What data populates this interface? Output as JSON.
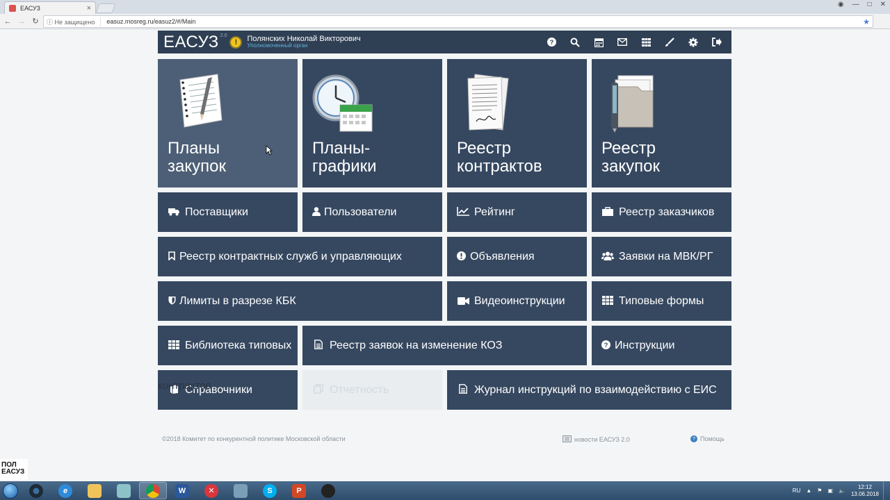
{
  "browser": {
    "tab_title": "ЕАСУЗ",
    "tab_close": "×",
    "security_label": "Не защищено",
    "url": "easuz.mosreg.ru/easuz2/#/Main"
  },
  "header": {
    "logo": "ЕАСУЗ",
    "logo_version": "2.0",
    "warning_mark": "!",
    "user_name": "Полянских Николай Викторович",
    "user_role": "Уполномоченный орган",
    "icons": [
      "question-circle-icon",
      "search-icon",
      "calendar-icon",
      "envelope-icon",
      "grid-icon",
      "brush-icon",
      "gear-icon",
      "sign-out-icon"
    ]
  },
  "big_tiles": [
    {
      "label_line1": "Планы",
      "label_line2": "закупок",
      "icon": "notepad-pencil-icon"
    },
    {
      "label_line1": "Планы-",
      "label_line2": "графики",
      "icon": "clock-calendar-icon"
    },
    {
      "label_line1": "Реестр",
      "label_line2": "контрактов",
      "icon": "contract-papers-icon"
    },
    {
      "label_line1": "Реестр",
      "label_line2": "закупок",
      "icon": "folder-pen-icon"
    }
  ],
  "tiles": {
    "suppliers": "Поставщики",
    "users": "Пользователи",
    "rating": "Рейтинг",
    "customers_registry": "Реестр заказчиков",
    "contract_services": "Реестр контрактных служб и управляющих",
    "announcements": "Объявления",
    "mvk_requests": "Заявки на МВК/РГ",
    "kbk_limits": "Лимиты в разрезе КБК",
    "video_instructions": "Видеоинструкции",
    "typical_forms": "Типовые формы",
    "library": "Библиотека типовых",
    "library_overflow": "контрактов",
    "koz_requests": "Реестр заявок на изменение КОЗ",
    "instructions": "Инструкции",
    "references": "Справочники",
    "reports": "Отчетность",
    "eis_journal": "Журнал инструкций по взаимодействию с ЕИС"
  },
  "footer": {
    "copyright": "©2018 Комитет по конкурентной политике Московской области",
    "news": "новости ЕАСУЗ 2.0",
    "help": "Помощь"
  },
  "watermark": {
    "line1": "ПОЛ",
    "line2": "ЕАСУЗ"
  },
  "taskbar": {
    "apps": [
      "chrome-icon-app",
      "ie-icon",
      "explorer-icon",
      "app-icon",
      "chrome-icon",
      "word-icon",
      "app-red-icon",
      "app-tool-icon",
      "skype-icon",
      "powerpoint-icon",
      "obs-icon"
    ],
    "lang": "RU",
    "time": "12:12",
    "date": "13.06.2018"
  },
  "colors": {
    "tile": "#364860",
    "header": "#2f3f54",
    "disabled_tile": "#e9edf0",
    "page_bg": "#f3f5f6"
  }
}
